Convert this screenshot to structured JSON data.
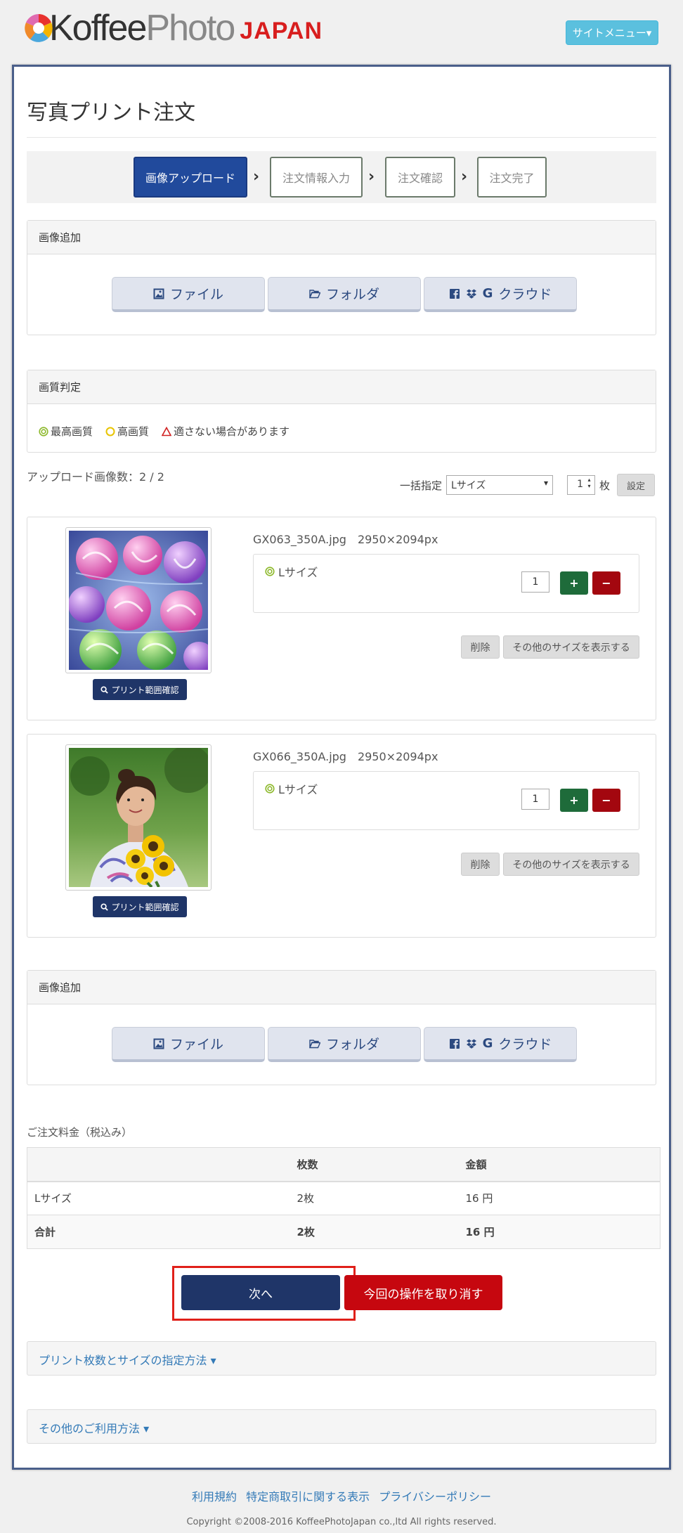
{
  "header": {
    "logo_text_dark": "Koffee",
    "logo_text_light": "Photo",
    "logo_japan": "JAPAN",
    "site_menu": "サイトメニュー▾"
  },
  "page": {
    "title": "写真プリント注文"
  },
  "steps": [
    {
      "label": "画像アップロード"
    },
    {
      "label": "注文情報入力"
    },
    {
      "label": "注文確認"
    },
    {
      "label": "注文完了"
    }
  ],
  "image_add": {
    "heading": "画像追加",
    "file": "ファイル",
    "folder": "フォルダ",
    "cloud": "クラウド"
  },
  "quality": {
    "heading": "画質判定",
    "best": "最高画質",
    "high": "高画質",
    "warning": "適さない場合があります"
  },
  "upload": {
    "count_text": "アップロード画像数：2 / 2",
    "bulk_label": "一括指定",
    "bulk_size": "Lサイズ",
    "bulk_qty": "1",
    "bulk_unit": "枚",
    "bulk_set": "設定"
  },
  "items": [
    {
      "filename": "GX063_350A.jpg　2950×2094px",
      "size": "Lサイズ",
      "qty": "1",
      "plus": "+",
      "minus": "−",
      "delete": "削除",
      "other_sizes": "その他のサイズを表示する",
      "range": "プリント範囲確認"
    },
    {
      "filename": "GX066_350A.jpg　2950×2094px",
      "size": "Lサイズ",
      "qty": "1",
      "plus": "+",
      "minus": "−",
      "delete": "削除",
      "other_sizes": "その他のサイズを表示する",
      "range": "プリント範囲確認"
    }
  ],
  "fee": {
    "title": "ご注文料金（税込み）",
    "col_qty": "枚数",
    "col_amount": "金額",
    "rows": [
      {
        "name": "Lサイズ",
        "qty": "2枚",
        "amount": "16 円"
      }
    ],
    "total": {
      "name": "合計",
      "qty": "2枚",
      "amount": "16 円"
    }
  },
  "actions": {
    "next": "次へ",
    "cancel": "今回の操作を取り消す"
  },
  "accordions": {
    "howto": "プリント枚数とサイズの指定方法 ▾",
    "other": "その他のご利用方法 ▾"
  },
  "footer": {
    "terms": "利用規約",
    "law": "特定商取引に関する表示",
    "privacy": "プライバシーポリシー",
    "copyright": "Copyright ©2008-2016 KoffeePhotoJapan co.,ltd All rights reserved."
  },
  "colors": {
    "primary_navy": "#1f3568",
    "active_step": "#214a9c",
    "danger": "#c6070f",
    "success": "#1e6b3a",
    "info": "#5bc0de",
    "link": "#337ab7"
  }
}
